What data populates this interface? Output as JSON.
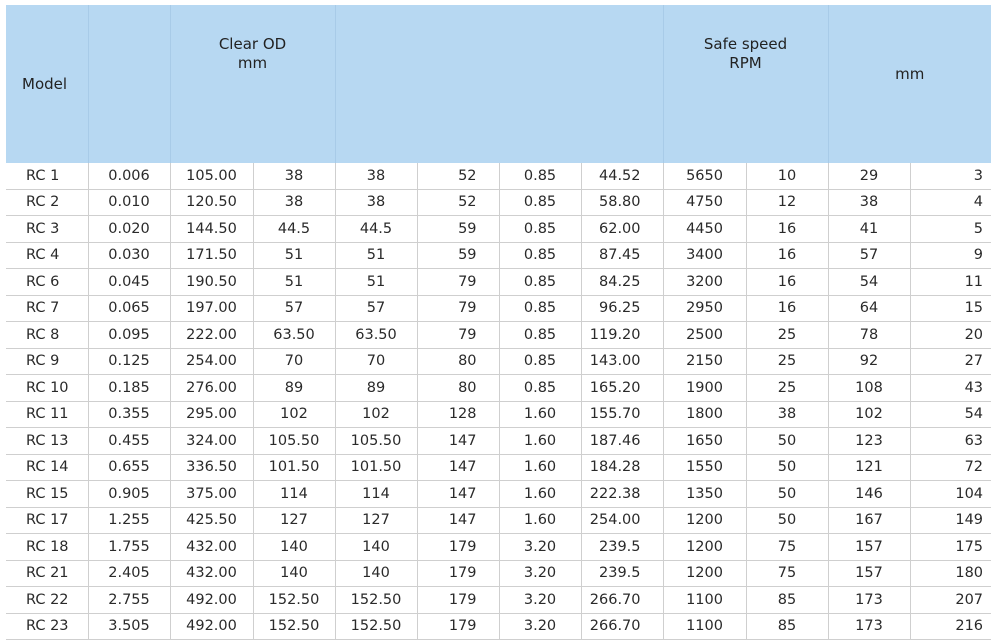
{
  "header": {
    "model": "Model",
    "clear_od_title": "Clear OD",
    "clear_od_unit": "mm",
    "safe_speed_title": "Safe speed",
    "safe_speed_unit": "RPM",
    "mm_unit": "mm"
  },
  "rows": [
    [
      "RC 1",
      "0.006",
      "105.00",
      "38",
      "38",
      "52",
      "0.85",
      "44.52",
      "5650",
      "10",
      "29",
      "3"
    ],
    [
      "RC 2",
      "0.010",
      "120.50",
      "38",
      "38",
      "52",
      "0.85",
      "58.80",
      "4750",
      "12",
      "38",
      "4"
    ],
    [
      "RC 3",
      "0.020",
      "144.50",
      "44.5",
      "44.5",
      "59",
      "0.85",
      "62.00",
      "4450",
      "16",
      "41",
      "5"
    ],
    [
      "RC 4",
      "0.030",
      "171.50",
      "51",
      "51",
      "59",
      "0.85",
      "87.45",
      "3400",
      "16",
      "57",
      "9"
    ],
    [
      "RC 6",
      "0.045",
      "190.50",
      "51",
      "51",
      "79",
      "0.85",
      "84.25",
      "3200",
      "16",
      "54",
      "11"
    ],
    [
      "RC 7",
      "0.065",
      "197.00",
      "57",
      "57",
      "79",
      "0.85",
      "96.25",
      "2950",
      "16",
      "64",
      "15"
    ],
    [
      "RC 8",
      "0.095",
      "222.00",
      "63.50",
      "63.50",
      "79",
      "0.85",
      "119.20",
      "2500",
      "25",
      "78",
      "20"
    ],
    [
      "RC 9",
      "0.125",
      "254.00",
      "70",
      "70",
      "80",
      "0.85",
      "143.00",
      "2150",
      "25",
      "92",
      "27"
    ],
    [
      "RC 10",
      "0.185",
      "276.00",
      "89",
      "89",
      "80",
      "0.85",
      "165.20",
      "1900",
      "25",
      "108",
      "43"
    ],
    [
      "RC 11",
      "0.355",
      "295.00",
      "102",
      "102",
      "128",
      "1.60",
      "155.70",
      "1800",
      "38",
      "102",
      "54"
    ],
    [
      "RC 13",
      "0.455",
      "324.00",
      "105.50",
      "105.50",
      "147",
      "1.60",
      "187.46",
      "1650",
      "50",
      "123",
      "63"
    ],
    [
      "RC 14",
      "0.655",
      "336.50",
      "101.50",
      "101.50",
      "147",
      "1.60",
      "184.28",
      "1550",
      "50",
      "121",
      "72"
    ],
    [
      "RC 15",
      "0.905",
      "375.00",
      "114",
      "114",
      "147",
      "1.60",
      "222.38",
      "1350",
      "50",
      "146",
      "104"
    ],
    [
      "RC 17",
      "1.255",
      "425.50",
      "127",
      "127",
      "147",
      "1.60",
      "254.00",
      "1200",
      "50",
      "167",
      "149"
    ],
    [
      "RC 18",
      "1.755",
      "432.00",
      "140",
      "140",
      "179",
      "3.20",
      "239.5",
      "1200",
      "75",
      "157",
      "175"
    ],
    [
      "RC 21",
      "2.405",
      "432.00",
      "140",
      "140",
      "179",
      "3.20",
      "239.5",
      "1200",
      "75",
      "157",
      "180"
    ],
    [
      "RC 22",
      "2.755",
      "492.00",
      "152.50",
      "152.50",
      "179",
      "3.20",
      "266.70",
      "1100",
      "85",
      "173",
      "207"
    ],
    [
      "RC 23",
      "3.505",
      "492.00",
      "152.50",
      "152.50",
      "179",
      "3.20",
      "266.70",
      "1100",
      "85",
      "173",
      "216"
    ]
  ]
}
